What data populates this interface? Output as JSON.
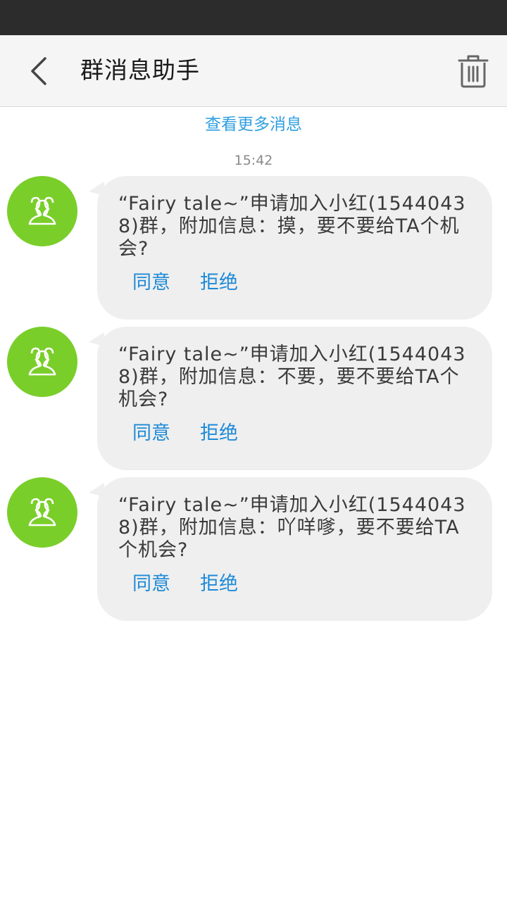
{
  "header": {
    "title": "群消息助手"
  },
  "more_link": "查看更多消息",
  "timestamp": "15:42",
  "messages": [
    {
      "text": "“Fairy tale~”申请加入小红(15440438)群，附加信息：摸，要不要给TA个机会?",
      "accept_label": "同意",
      "reject_label": "拒绝"
    },
    {
      "text": "“Fairy tale~”申请加入小红(15440438)群，附加信息：不要，要不要给TA个机会?",
      "accept_label": "同意",
      "reject_label": "拒绝"
    },
    {
      "text": "“Fairy tale~”申请加入小红(15440438)群，附加信息：吖咩嗲，要不要给TA个机会?",
      "accept_label": "同意",
      "reject_label": "拒绝"
    }
  ],
  "colors": {
    "accent": "#2f9fe0",
    "action": "#1d8ad8",
    "avatar": "#7ace2a",
    "bubble": "#efefef",
    "status_bar": "#2c2c2c"
  },
  "icons": {
    "back": "chevron-left-icon",
    "trash": "trash-icon",
    "avatar": "group-icon"
  }
}
